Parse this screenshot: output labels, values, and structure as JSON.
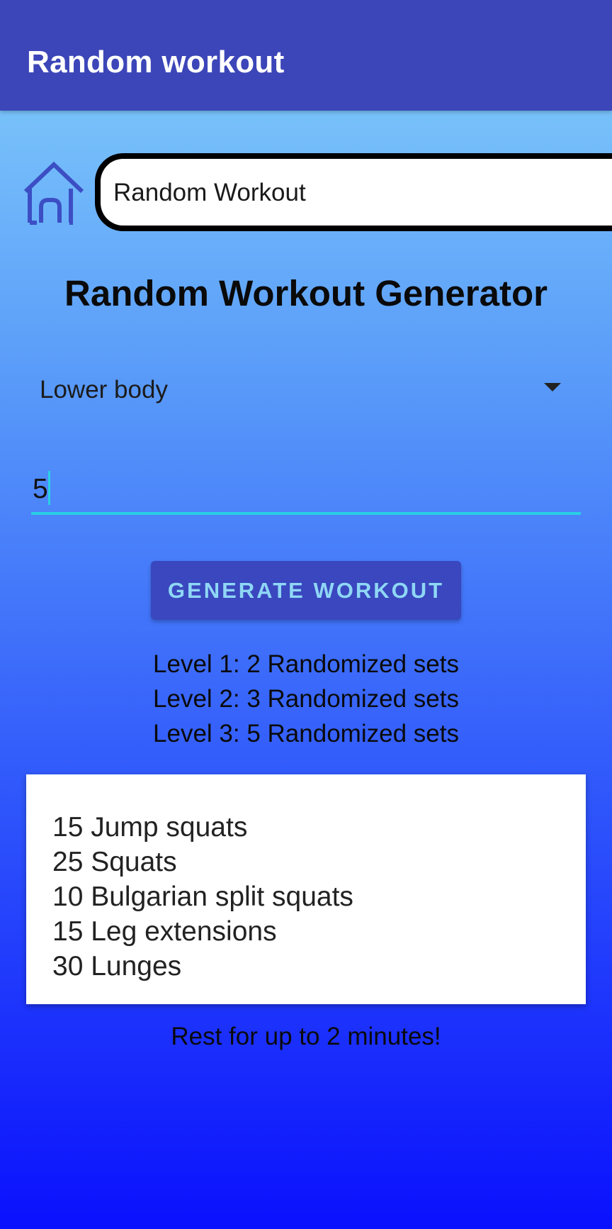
{
  "app_bar": {
    "title": "Random workout"
  },
  "header": {
    "home_icon": "home-icon",
    "page_title": "Random Workout"
  },
  "main": {
    "heading": "Random Workout Generator",
    "body_part_select": {
      "selected": "Lower body"
    },
    "sets_input": {
      "value": "5"
    },
    "generate_button_label": "GENERATE WORKOUT",
    "levels": [
      "Level 1: 2 Randomized sets",
      "Level 2: 3 Randomized sets",
      "Level 3: 5 Randomized sets"
    ],
    "workout": [
      "15 Jump squats",
      "25 Squats",
      "10 Bulgarian split squats",
      "15 Leg extensions",
      "30 Lunges"
    ],
    "rest_text": "Rest for up to 2 minutes!"
  },
  "colors": {
    "app_bar": "#3c46b8",
    "button": "#3a47be",
    "button_text": "#8fd7f5",
    "input_underline": "#29cfe4",
    "gradient_top": "#84d1fb",
    "gradient_bottom": "#0a10fd"
  }
}
